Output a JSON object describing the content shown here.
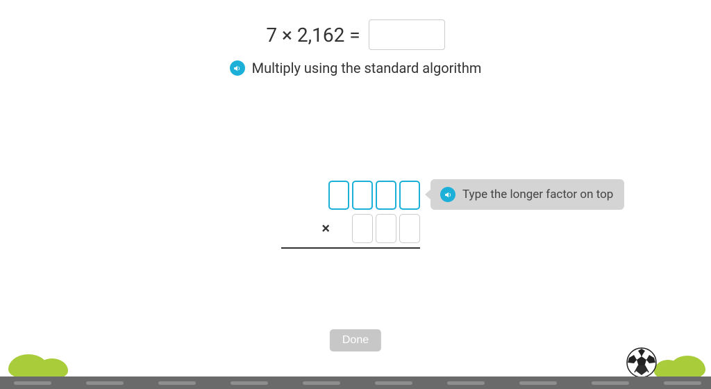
{
  "equation": "7 × 2,162 =",
  "instruction": "Multiply using the standard algorithm",
  "tooltip": "Type the longer factor on top",
  "multiply_symbol": "×",
  "done_label": "Done",
  "work": {
    "top_digits": 4,
    "bottom_digits": 3
  }
}
